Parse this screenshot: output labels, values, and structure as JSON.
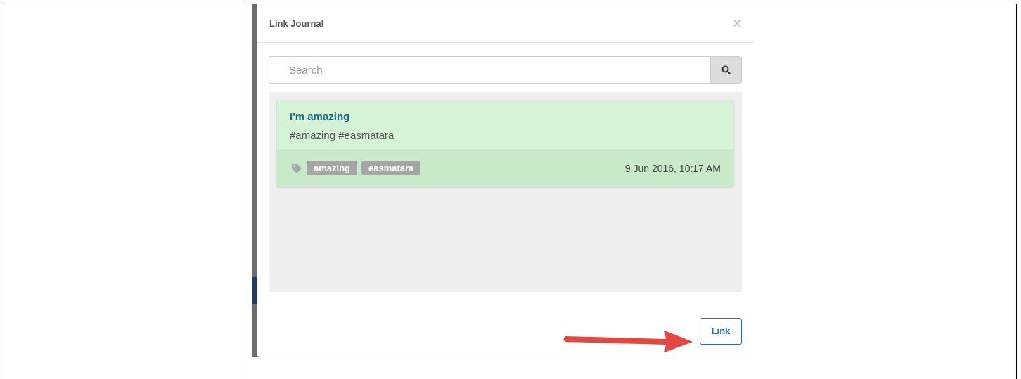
{
  "dialog": {
    "title": "Link Journal",
    "close": "×",
    "search": {
      "placeholder": "Search"
    },
    "entries": [
      {
        "title": "I'm amazing",
        "text": "#amazing #easmatara",
        "tags": [
          "amazing",
          "easmatara"
        ],
        "date": "9 Jun 2016, 10:17 AM",
        "selected": true
      }
    ],
    "buttons": [
      {
        "label": "Link"
      }
    ]
  }
}
